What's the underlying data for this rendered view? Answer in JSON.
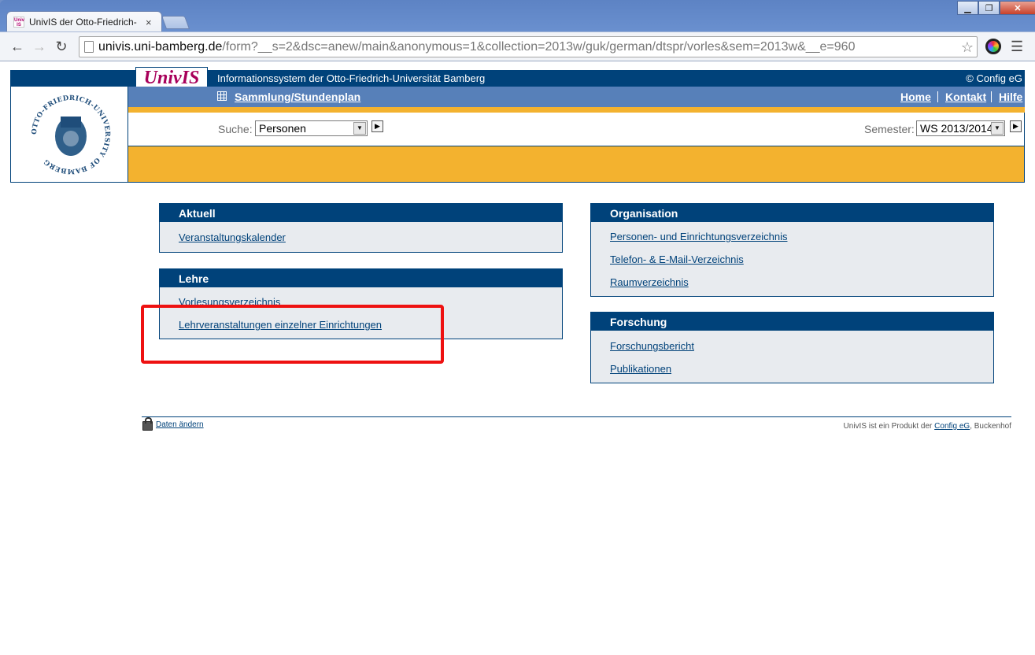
{
  "browser": {
    "tab_title": "UnivIS der Otto-Friedrich-",
    "tab_close": "×",
    "favicon_text": "Univ IS",
    "url_host": "univis.uni-bamberg.de",
    "url_path": "/form?__s=2&dsc=anew/main&anonymous=1&collection=2013w/guk/german/dtspr/vorles&sem=2013w&__e=960",
    "win_minimize": "▁",
    "win_restore": "❐",
    "win_close": "✕",
    "back": "←",
    "forward": "→",
    "reload": "↻",
    "star": "☆",
    "menu": "☰"
  },
  "header": {
    "logo": "UnivIS",
    "info_text": "Informationssystem der Otto-Friedrich-Universität Bamberg",
    "copyright": "© Config eG",
    "seal_text": "OTTO-FRIEDRICH-UNIVERSITY OF BAMBERG",
    "menu_link": "Sammlung/Stundenplan",
    "nav": {
      "home": "Home",
      "kontakt": "Kontakt",
      "hilfe": "Hilfe"
    }
  },
  "search": {
    "label": "Suche:",
    "value": "Personen",
    "semester_label": "Semester:",
    "semester_value": "WS 2013/2014"
  },
  "boxes": {
    "aktuell": {
      "title": "Aktuell",
      "links": [
        "Veranstaltungskalender"
      ]
    },
    "lehre": {
      "title": "Lehre",
      "links": [
        "Vorlesungsverzeichnis",
        "Lehrveranstaltungen einzelner Einrichtungen"
      ]
    },
    "organisation": {
      "title": "Organisation",
      "links": [
        "Personen- und Einrichtungsverzeichnis",
        "Telefon- & E-Mail-Verzeichnis",
        "Raumverzeichnis"
      ]
    },
    "forschung": {
      "title": "Forschung",
      "links": [
        "Forschungsbericht",
        "Publikationen"
      ]
    }
  },
  "footer": {
    "left_link": "Daten ändern",
    "right_prefix": "UnivIS ist ein Produkt der ",
    "right_link": "Config eG",
    "right_suffix": ", Buckenhof"
  },
  "colors": {
    "primary": "#00427a",
    "menubar": "#5780b9",
    "gold": "#f3b22f",
    "logo": "#a8005a",
    "highlight": "#ee1111"
  }
}
